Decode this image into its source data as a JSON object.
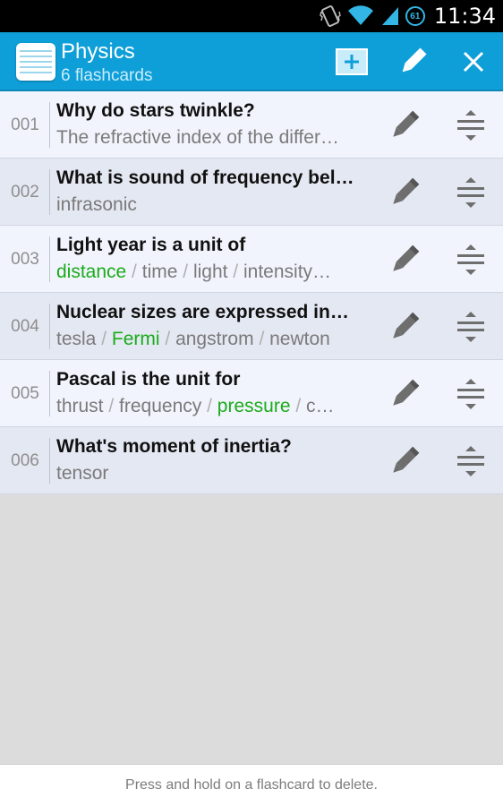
{
  "status_bar": {
    "battery_level": "61",
    "time": "11:34",
    "icons": [
      "vibrate-icon",
      "wifi-icon",
      "signal-icon",
      "battery-icon"
    ]
  },
  "action_bar": {
    "title": "Physics",
    "subtitle": "6 flashcards",
    "icons": [
      "deck-icon",
      "add-icon",
      "edit-icon",
      "close-icon"
    ],
    "accent": "#0e9fd9"
  },
  "flashcards": [
    {
      "number": "001",
      "question": "Why do stars twinkle?",
      "answers": [
        {
          "text": "The refractive index of the differ…",
          "correct": false
        }
      ]
    },
    {
      "number": "002",
      "question": "What is sound of frequency bel…",
      "answers": [
        {
          "text": "infrasonic",
          "correct": false
        }
      ]
    },
    {
      "number": "003",
      "question": "Light year is a unit of",
      "answers": [
        {
          "text": "distance",
          "correct": true
        },
        {
          "text": "time",
          "correct": false
        },
        {
          "text": "light",
          "correct": false
        },
        {
          "text": "intensity…",
          "correct": false
        }
      ]
    },
    {
      "number": "004",
      "question": "Nuclear sizes are expressed in…",
      "answers": [
        {
          "text": "tesla",
          "correct": false
        },
        {
          "text": "Fermi",
          "correct": true
        },
        {
          "text": "angstrom",
          "correct": false
        },
        {
          "text": "newton",
          "correct": false
        }
      ]
    },
    {
      "number": "005",
      "question": "Pascal is the unit for",
      "answers": [
        {
          "text": "thrust",
          "correct": false
        },
        {
          "text": "frequency",
          "correct": false
        },
        {
          "text": "pressure",
          "correct": true
        },
        {
          "text": "c…",
          "correct": false
        }
      ]
    },
    {
      "number": "006",
      "question": "What's moment of inertia?",
      "answers": [
        {
          "text": "tensor",
          "correct": false
        }
      ]
    }
  ],
  "answer_separator": " / ",
  "colors": {
    "correct": "#1aab1a",
    "row_light": "#f1f4fc",
    "row_dark": "#e4e8f2"
  },
  "footer": {
    "hint": "Press and hold on a flashcard to delete."
  }
}
